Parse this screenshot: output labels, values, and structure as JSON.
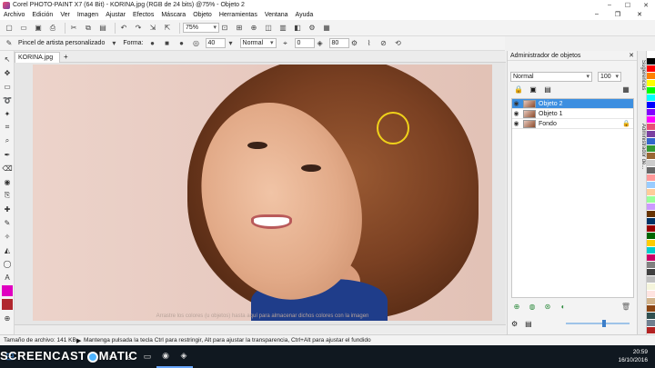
{
  "window": {
    "title": "Corel PHOTO-PAINT X7 (64 Bit) - KORINA.jpg (RGB de 24 bits) @75% - Objeto 2"
  },
  "menu": [
    "Archivo",
    "Edición",
    "Ver",
    "Imagen",
    "Ajustar",
    "Efectos",
    "Máscara",
    "Objeto",
    "Herramientas",
    "Ventana",
    "Ayuda"
  ],
  "toolbar": {
    "zoom": "75%"
  },
  "property_bar": {
    "tool_name": "Pincel de artista personalizado",
    "shape_label": "Forma:",
    "size_value": "40",
    "merge_mode": "Normal",
    "transparency_value": "0",
    "opacity_value": "80"
  },
  "document": {
    "tab": "KORINA.jpg",
    "hint": "Arrastre los colores (u objetos) hasta aquí para almacenar dichos colores con la imagen"
  },
  "object_manager": {
    "title": "Administrador de objetos",
    "merge_mode": "Normal",
    "opacity": "100",
    "layers": [
      {
        "name": "Objeto 2",
        "selected": true
      },
      {
        "name": "Objeto 1",
        "selected": false
      },
      {
        "name": "Fondo",
        "selected": false
      }
    ]
  },
  "side_tabs": [
    "Sugerencias",
    "Administrador de..."
  ],
  "status": {
    "size": "Tamaño de archivo: 141 KB",
    "message": "Mantenga pulsada la tecla Ctrl para restringir, Alt para ajustar la transparencia, Ctrl+Alt para ajustar el fundido"
  },
  "taskbar": {
    "time": "20:59",
    "date": "16/10/2016"
  },
  "watermark": {
    "text_left": "SCREENCAST",
    "text_right": "MATIC"
  },
  "colors": {
    "accent": "#3d8fe0",
    "palette": [
      "#ffffff",
      "#000000",
      "#ff0000",
      "#ff8000",
      "#ffff00",
      "#00ff00",
      "#00ffff",
      "#0000ff",
      "#8000ff",
      "#ff00ff",
      "#e94e77",
      "#7b3fa0",
      "#3366cc",
      "#339933",
      "#996633",
      "#cccccc",
      "#666666",
      "#ff9999",
      "#99ccff",
      "#ffcc99",
      "#99ff99",
      "#cc99ff",
      "#663300",
      "#003366",
      "#990000",
      "#006600",
      "#ffcc00",
      "#00cccc",
      "#cc0066",
      "#808080",
      "#404040",
      "#c0c0c0",
      "#f5f5dc",
      "#ffe4e1",
      "#d2b48c",
      "#8b4513",
      "#2f4f4f",
      "#708090",
      "#b22222"
    ]
  }
}
